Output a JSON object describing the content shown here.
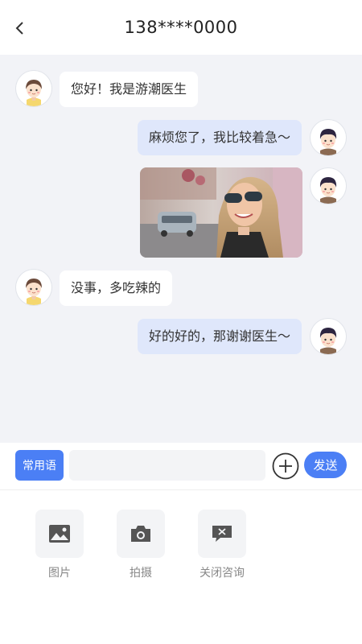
{
  "header": {
    "title": "138****0000",
    "back_icon": "chevron-left-icon"
  },
  "messages": [
    {
      "side": "left",
      "sender": "doctor",
      "type": "text",
      "text": "您好！我是游潮医生"
    },
    {
      "side": "right",
      "sender": "patient",
      "type": "text",
      "text": "麻烦您了，我比较着急～"
    },
    {
      "side": "right",
      "sender": "patient",
      "type": "image",
      "image": "photo of smiling woman with sunglasses on street"
    },
    {
      "side": "left",
      "sender": "doctor",
      "type": "text",
      "text": "没事，多吃辣的"
    },
    {
      "side": "right",
      "sender": "patient",
      "type": "text",
      "text": "好的好的，那谢谢医生～"
    }
  ],
  "input_bar": {
    "phrases_label": "常用语",
    "input_value": "",
    "mic_icon": "microphone-icon",
    "plus_icon": "plus-circle-icon",
    "send_label": "发送"
  },
  "tools": [
    {
      "label": "图片",
      "icon": "image-icon"
    },
    {
      "label": "拍摄",
      "icon": "camera-icon"
    },
    {
      "label": "关闭咨询",
      "icon": "close-chat-icon"
    }
  ],
  "colors": {
    "accent": "#4b7ff5",
    "chat_bg": "#f2f3f7",
    "outgoing_bubble": "#dfe7fb",
    "tool_bg": "#f3f4f6"
  }
}
